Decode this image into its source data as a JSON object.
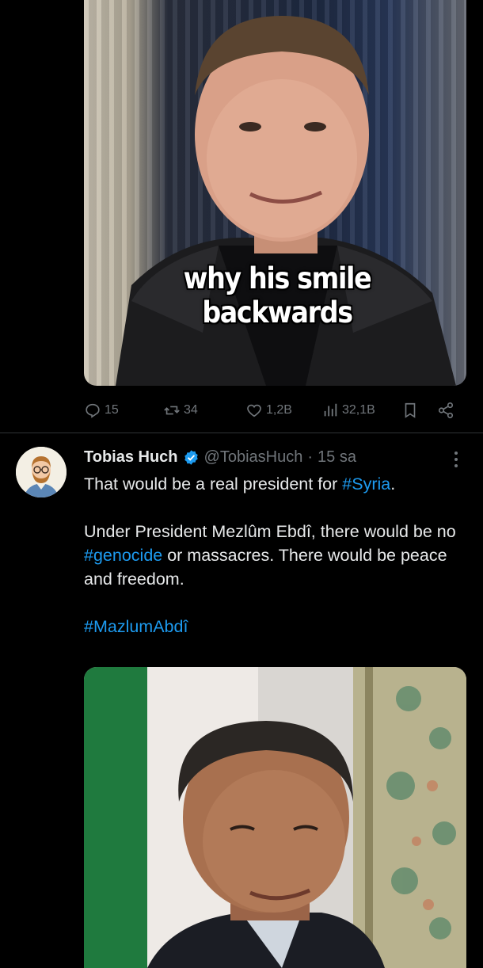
{
  "tweet1": {
    "image_caption": "why his smile backwards",
    "stats": {
      "replies": "15",
      "retweets": "34",
      "likes": "1,2B",
      "views": "32,1B"
    }
  },
  "tweet2": {
    "author_name": "Tobias Huch",
    "handle": "@TobiasHuch",
    "separator": "·",
    "time": "15 sa",
    "line1_text": "That would be a real president for ",
    "line1_tag": "#Syria",
    "line1_end": ".",
    "para2_a": "Under President Mezlûm Ebdî, there would be no ",
    "para2_tag": "#genocide",
    "para2_b": " or massacres. There would be peace and freedom.",
    "hashtag": "#MazlumAbdî"
  },
  "colors": {
    "background": "#000000",
    "text": "#e7e9ea",
    "muted": "#71767b",
    "link": "#1d9bf0"
  },
  "icons": [
    "reply-icon",
    "retweet-icon",
    "like-icon",
    "views-icon",
    "bookmark-icon",
    "share-icon",
    "verified-icon",
    "more-icon"
  ]
}
